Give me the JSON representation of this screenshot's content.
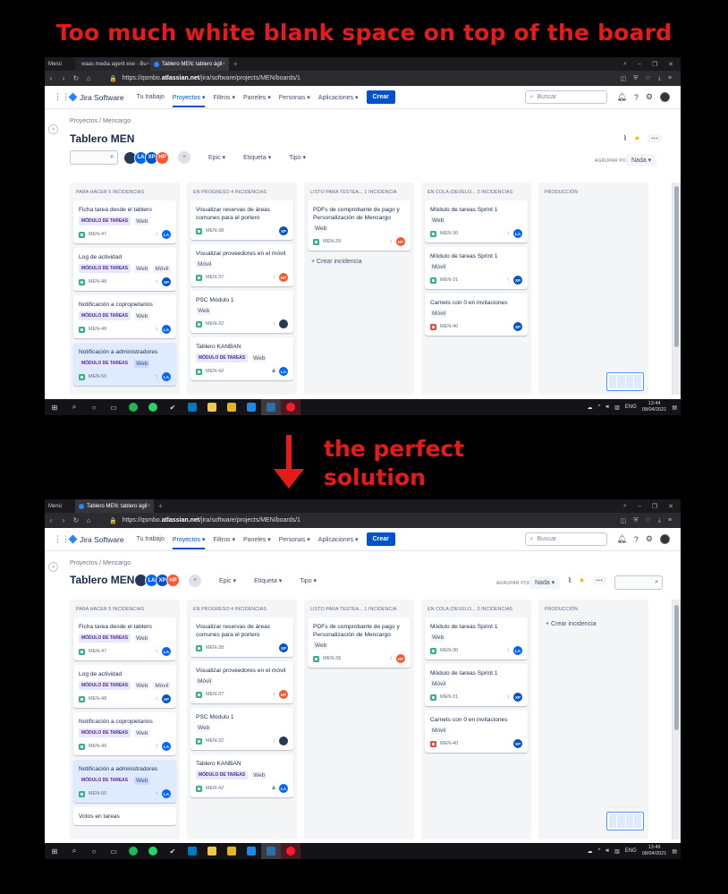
{
  "captions": {
    "top": "Too much white blank space on top of the board",
    "middle_line1": "the perfect",
    "middle_line2": "solution"
  },
  "browser": {
    "menu_label": "Menú",
    "tabs": [
      {
        "label": "waas media agent exe - Bu",
        "fav_color": "#34a853"
      },
      {
        "label": "Tablero MEN: tablero ágil",
        "fav_color": "#2684ff"
      }
    ],
    "url_prefix": "https://qsmbo.",
    "url_domain": "atlassian.net",
    "url_path": "/jira/software/projects/MEN/boards/1"
  },
  "jira": {
    "product": "Jira Software",
    "nav": [
      "Tu trabajo",
      "Proyectos",
      "Filtros",
      "Paneles",
      "Personas",
      "Aplicaciones"
    ],
    "create": "Crear",
    "search_placeholder": "Buscar"
  },
  "board": {
    "crumb1": "Proyectos",
    "crumb_sep": "/",
    "crumb2": "Mencargo",
    "title": "Tablero MEN",
    "avatars": [
      {
        "label": "",
        "kind": "dark"
      },
      {
        "label": "LA",
        "kind": "la"
      },
      {
        "label": "XP",
        "kind": "xp"
      },
      {
        "label": "HP",
        "kind": "hp"
      }
    ],
    "filter_epic": "Epic",
    "filter_label": "Etiqueta",
    "filter_type": "Tipo",
    "group_by": "AGRUPAR POR",
    "group_value": "Nada",
    "create_issue": "+ Crear incidencia",
    "columns": [
      {
        "title": "PARA HACER 5 INCIDENCIAS",
        "cards": [
          {
            "title": "Ficha tarea desde el tablero",
            "epic": "MÓDULO DE TAREAS",
            "labels": [
              "Web"
            ],
            "key": "MEN-47",
            "type": "story",
            "priority": "med",
            "assignee": "LA",
            "akind": "la"
          },
          {
            "title": "Log de actividad",
            "epic": "MÓDULO DE TAREAS",
            "labels": [
              "Web",
              "Móvil"
            ],
            "key": "MEN-48",
            "type": "story",
            "priority": "med",
            "assignee": "XP",
            "akind": "xp"
          },
          {
            "title": "Notificación a copropietarios",
            "epic": "MÓDULO DE TAREAS",
            "labels": [
              "Web"
            ],
            "key": "MEN-49",
            "type": "story",
            "priority": "med",
            "assignee": "LA",
            "akind": "la"
          },
          {
            "title": "Notificación a administradores",
            "epic": "MÓDULO DE TAREAS",
            "labels": [
              "Web"
            ],
            "key": "MEN-50",
            "type": "story",
            "priority": "med",
            "assignee": "LA",
            "akind": "la",
            "selected": true
          },
          {
            "title": "Votos en tareas",
            "epic": "",
            "labels": [],
            "key": "",
            "type": "story",
            "priority": "",
            "assignee": "",
            "akind": "",
            "only2": true
          }
        ]
      },
      {
        "title": "EN PROGRESO 4 INCIDENCIAS",
        "cards": [
          {
            "title": "Visualizar reservas de áreas comunes para el portero",
            "epic": "",
            "labels": [],
            "key": "MEN-38",
            "type": "story",
            "priority": "",
            "assignee": "XP",
            "akind": "xp"
          },
          {
            "title": "Visualizar proveedores en el móvil",
            "epic": "",
            "labels": [
              "Móvil"
            ],
            "key": "MEN-37",
            "type": "story",
            "priority": "med",
            "assignee": "HP",
            "akind": "hp"
          },
          {
            "title": "PSC Módulo 1",
            "epic": "",
            "labels": [
              "Web"
            ],
            "key": "MEN-32",
            "type": "story",
            "priority": "med",
            "assignee": "",
            "akind": "dark"
          },
          {
            "title": "Tablero KANBAN",
            "epic": "MÓDULO DE TAREAS",
            "labels": [
              "Web"
            ],
            "key": "MEN-42",
            "type": "story",
            "priority": "low",
            "assignee": "LA",
            "akind": "la"
          }
        ]
      },
      {
        "title": "LISTO PARA TESTEA... 1 INCIDENCIA",
        "cards": [
          {
            "title": "PDFs de comprobante de pago y Personalización de Mencargo",
            "epic": "",
            "labels": [
              "Web"
            ],
            "key": "MEN-39",
            "type": "story",
            "priority": "med",
            "assignee": "HP",
            "akind": "hp"
          }
        ],
        "create_in": "s1"
      },
      {
        "title": "EN COLA (DEVELO... 3 INCIDENCIAS",
        "cards": [
          {
            "title": "Módulo de tareas Sprint 1",
            "epic": "",
            "labels": [
              "Web"
            ],
            "key": "MEN-30",
            "type": "story",
            "priority": "med",
            "assignee": "LA",
            "akind": "la"
          },
          {
            "title": "Módulo de tareas Sprint 1",
            "epic": "",
            "labels": [
              "Móvil"
            ],
            "key": "MEN-31",
            "type": "story",
            "priority": "med",
            "assignee": "XP",
            "akind": "xp"
          },
          {
            "title": "Carnets con 0 en invitaciones",
            "epic": "",
            "labels": [
              "Móvil"
            ],
            "key": "MEN-40",
            "type": "bug",
            "priority": "",
            "assignee": "XP",
            "akind": "xp"
          }
        ]
      },
      {
        "title": "PRODUCCIÓN",
        "cards": [],
        "create_in": "s2"
      }
    ]
  },
  "taskbar": {
    "lang": "ENG",
    "time1": "13:44",
    "time2": "13:49",
    "date": "08/04/2021",
    "badge": "5",
    "notif": "3"
  }
}
